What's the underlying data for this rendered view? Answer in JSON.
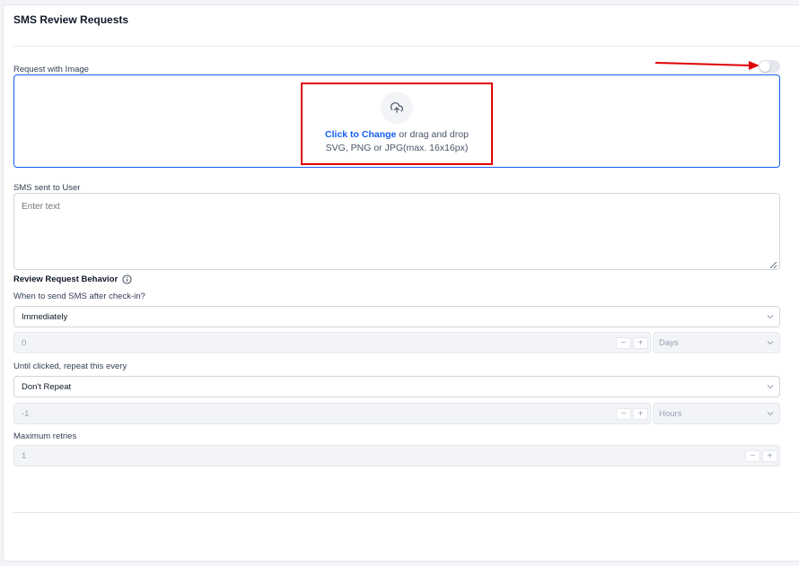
{
  "section": {
    "title": "SMS Review Requests"
  },
  "request_image": {
    "label": "Request with Image",
    "toggle_on": false,
    "upload": {
      "icon": "upload-cloud-icon",
      "link_text": "Click to Change",
      "drag_text": " or drag and drop",
      "formats_text": "SVG, PNG or JPG(max. 16x16px)"
    }
  },
  "sms_text": {
    "label": "SMS sent to User",
    "placeholder": "Enter text",
    "value": ""
  },
  "behavior": {
    "heading": "Review Request Behavior",
    "info_icon": "info-circle-icon",
    "send_after": {
      "label": "When to send SMS after check-in?",
      "selected": "Immediately",
      "amount": "0",
      "unit": "Days"
    },
    "repeat": {
      "label": "Until clicked, repeat this every",
      "selected": "Don't Repeat",
      "amount": "-1",
      "unit": "Hours"
    },
    "max_retries": {
      "label": "Maximum retries",
      "value": "1"
    },
    "stepper": {
      "minus": "−",
      "plus": "+"
    }
  },
  "colors": {
    "accent": "#155eef",
    "annotation_red": "#e00000",
    "border": "#d0d5dd",
    "disabled_bg": "#f2f4f7"
  }
}
